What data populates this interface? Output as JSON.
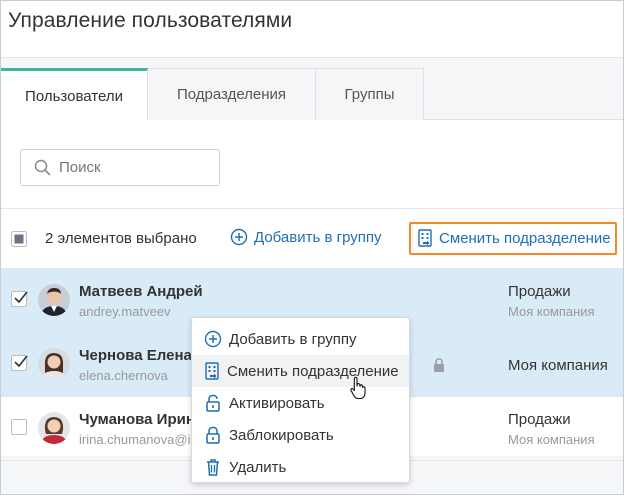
{
  "header": {
    "title": "Управление пользователями"
  },
  "tabs": [
    {
      "label": "Пользователи",
      "active": true
    },
    {
      "label": "Подразделения",
      "active": false
    },
    {
      "label": "Группы",
      "active": false
    }
  ],
  "search": {
    "placeholder": "Поиск",
    "value": ""
  },
  "toolbar": {
    "selected_count": "2 элементов выбрано",
    "add_to_group": "Добавить в группу",
    "change_department": "Сменить подразделение"
  },
  "users": [
    {
      "name": "Матвеев Андрей",
      "login": "andrey.matveev",
      "department": "Продажи",
      "company": "Моя компания",
      "selected": true
    },
    {
      "name": "Чернова Елена",
      "login": "elena.chernova",
      "department": "",
      "company": "Моя компания",
      "selected": true,
      "locked": true
    },
    {
      "name": "Чуманова Ирин",
      "login": "irina.chumanova@i",
      "department": "Продажи",
      "company": "Моя компания",
      "selected": false
    }
  ],
  "context_menu": {
    "items": [
      {
        "label": "Добавить в группу",
        "icon": "plus-circle-icon"
      },
      {
        "label": "Сменить подразделение",
        "icon": "building-icon"
      },
      {
        "label": "Активировать",
        "icon": "unlock-icon"
      },
      {
        "label": "Заблокировать",
        "icon": "lock-icon"
      },
      {
        "label": "Удалить",
        "icon": "trash-icon"
      }
    ]
  },
  "colors": {
    "accent": "#1f6fb4",
    "tab_active": "#3fb59e",
    "highlight_border": "#f08a2b",
    "selected_row": "#daebf8"
  }
}
